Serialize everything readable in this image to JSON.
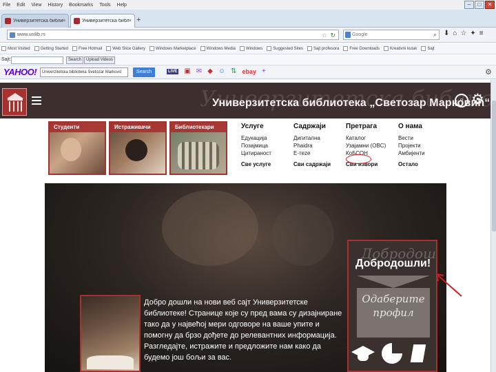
{
  "browser": {
    "menu": [
      "File",
      "Edit",
      "View",
      "History",
      "Bookmarks",
      "Tools",
      "Help"
    ],
    "tabs": [
      {
        "title": "Универзитетска библиотека"
      },
      {
        "title": "Универзитетска библиотека"
      }
    ],
    "url": "www.unilib.rs",
    "search_placeholder": "Google",
    "bookmarks": [
      "Most Visited",
      "Getting Started",
      "Free Hotmail",
      "Web Slice Gallery",
      "Windows Marketplace",
      "Windows Media",
      "Windows",
      "Suggested Sites",
      "Sajt profesora",
      "Free Downloads",
      "Kreativni kutak",
      "Sajt"
    ],
    "toolbar_label": "Sajt:",
    "toolbar_buttons": [
      "Search",
      "Upload Videos"
    ],
    "yahoo": {
      "logo": "YAHOO!",
      "search_value": "Univerzitetska biblioteka Svetozar Marković",
      "search_button": "Search",
      "live": "LIVE",
      "ebay": "ebay"
    }
  },
  "site": {
    "title": "Универзитетска библиотека „Светозар Марковић“",
    "profiles": [
      "Студенти",
      "Истраживачи",
      "Библиотекари"
    ],
    "menus": [
      {
        "head": "Услуге",
        "items": [
          "Едукација",
          "Позајмица",
          "Цитираност"
        ],
        "all": "Све услуге"
      },
      {
        "head": "Садржаји",
        "items": [
          "Дигитална",
          "Phaidra",
          "E-теze"
        ],
        "all": "Сви садржаји"
      },
      {
        "head": "Претрага",
        "items": [
          "Каталог",
          "Узајамни (OBC)",
          "КоБСОН"
        ],
        "all": "Сви извори"
      },
      {
        "head": "О нама",
        "items": [
          "Вести",
          "Пројекти",
          "Амбијенти"
        ],
        "all": "Остало"
      }
    ],
    "welcome_text": "Добро дошли на нови веб сајт Универзитетске библиотеке! Странице које су пред вама су дизајниране тако да у највећој мери одговоре на ваше упите и помогну да брзо дођете до релевантних информација. Разгледајте, истражите и предложите нам како да будемо још бољи за вас.",
    "welcome_box": {
      "script": "Добродошли",
      "title": "Добродошли!",
      "choose": "Одаберите профил"
    },
    "header_script": "Универзитетска библиотека"
  },
  "colors": {
    "brand_red": "#a7312f",
    "header_bg": "#3c2f2d",
    "annotation": "#d01e1e"
  }
}
